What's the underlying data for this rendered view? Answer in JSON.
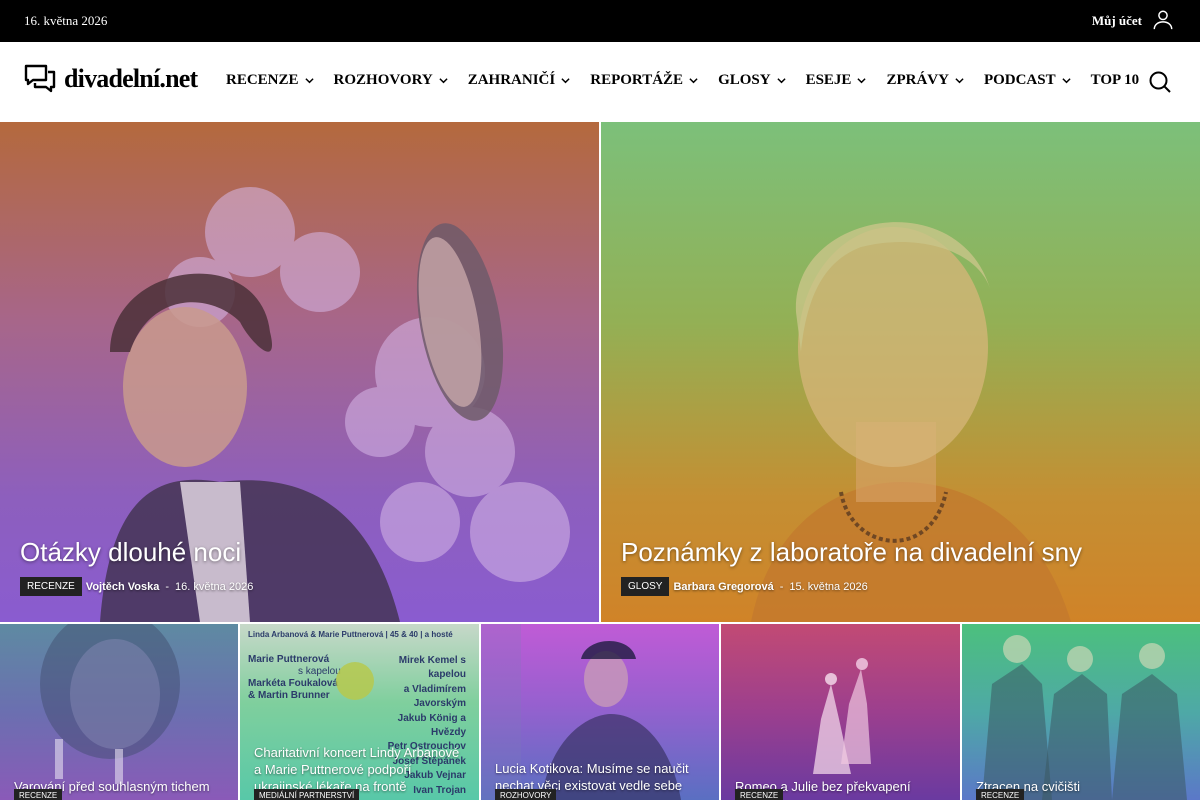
{
  "topbar": {
    "date": "16. května 2026",
    "account_label": "Můj účet"
  },
  "header": {
    "logo_text": "divadelní.net",
    "nav": [
      {
        "label": "RECENZE",
        "has_dropdown": true
      },
      {
        "label": "ROZHOVORY",
        "has_dropdown": true
      },
      {
        "label": "ZAHRANIČÍ",
        "has_dropdown": true
      },
      {
        "label": "REPORTÁŽE",
        "has_dropdown": true
      },
      {
        "label": "GLOSY",
        "has_dropdown": true
      },
      {
        "label": "ESEJE",
        "has_dropdown": true
      },
      {
        "label": "ZPRÁVY",
        "has_dropdown": true
      },
      {
        "label": "PODCAST",
        "has_dropdown": true
      },
      {
        "label": "TOP 10",
        "has_dropdown": false
      }
    ],
    "icons": {
      "account": "user-icon",
      "search": "search-icon",
      "logo": "chat-bubbles-icon",
      "dropdown": "chevron-down-icon"
    }
  },
  "hero": [
    {
      "title": "Otázky dlouhé noci",
      "category": "RECENZE",
      "author": "Vojtěch Voska",
      "separator": "-",
      "date": "16. května 2026",
      "tint": "#8d5fbd"
    },
    {
      "title": "Poznámky z laboratoře na divadelní sny",
      "category": "GLOSY",
      "author": "Barbara Gregorová",
      "separator": "-",
      "date": "15. května 2026",
      "tint": "#c48f33"
    }
  ],
  "tiles": [
    {
      "title": "Varování před souhlasným tichem",
      "category": "RECENZE"
    },
    {
      "title": "Charitativní koncert Lindy Arbanové a Marie Puttnerové podpoří ukrajinské lékaře na frontě",
      "category": "MEDIÁLNÍ PARTNERSTVÍ",
      "poster": {
        "header": "Linda Arbanová & Marie Puttnerová | 45 & 40 | a hosté",
        "left_names": [
          "Marie Puttnerová",
          "s kapelou",
          "Markéta Foukalová",
          "& Martin Brunner"
        ],
        "right_names": [
          "Mirek Kemel s kapelou",
          "a Vladimírem Javorským",
          "Jakub König a Hvězdy",
          "Petr Ostrouchov",
          "Josef Štěpánek",
          "Jakub Vejnar",
          "Ivan Trojan"
        ]
      }
    },
    {
      "title": "Lucia Kotikova: Musíme se naučit nechat věci existovat vedle sebe",
      "category": "ROZHOVORY"
    },
    {
      "title": "Romeo a Julie bez překvapení",
      "category": "RECENZE"
    },
    {
      "title": "Ztracen na cvičišti",
      "category": "RECENZE"
    }
  ]
}
